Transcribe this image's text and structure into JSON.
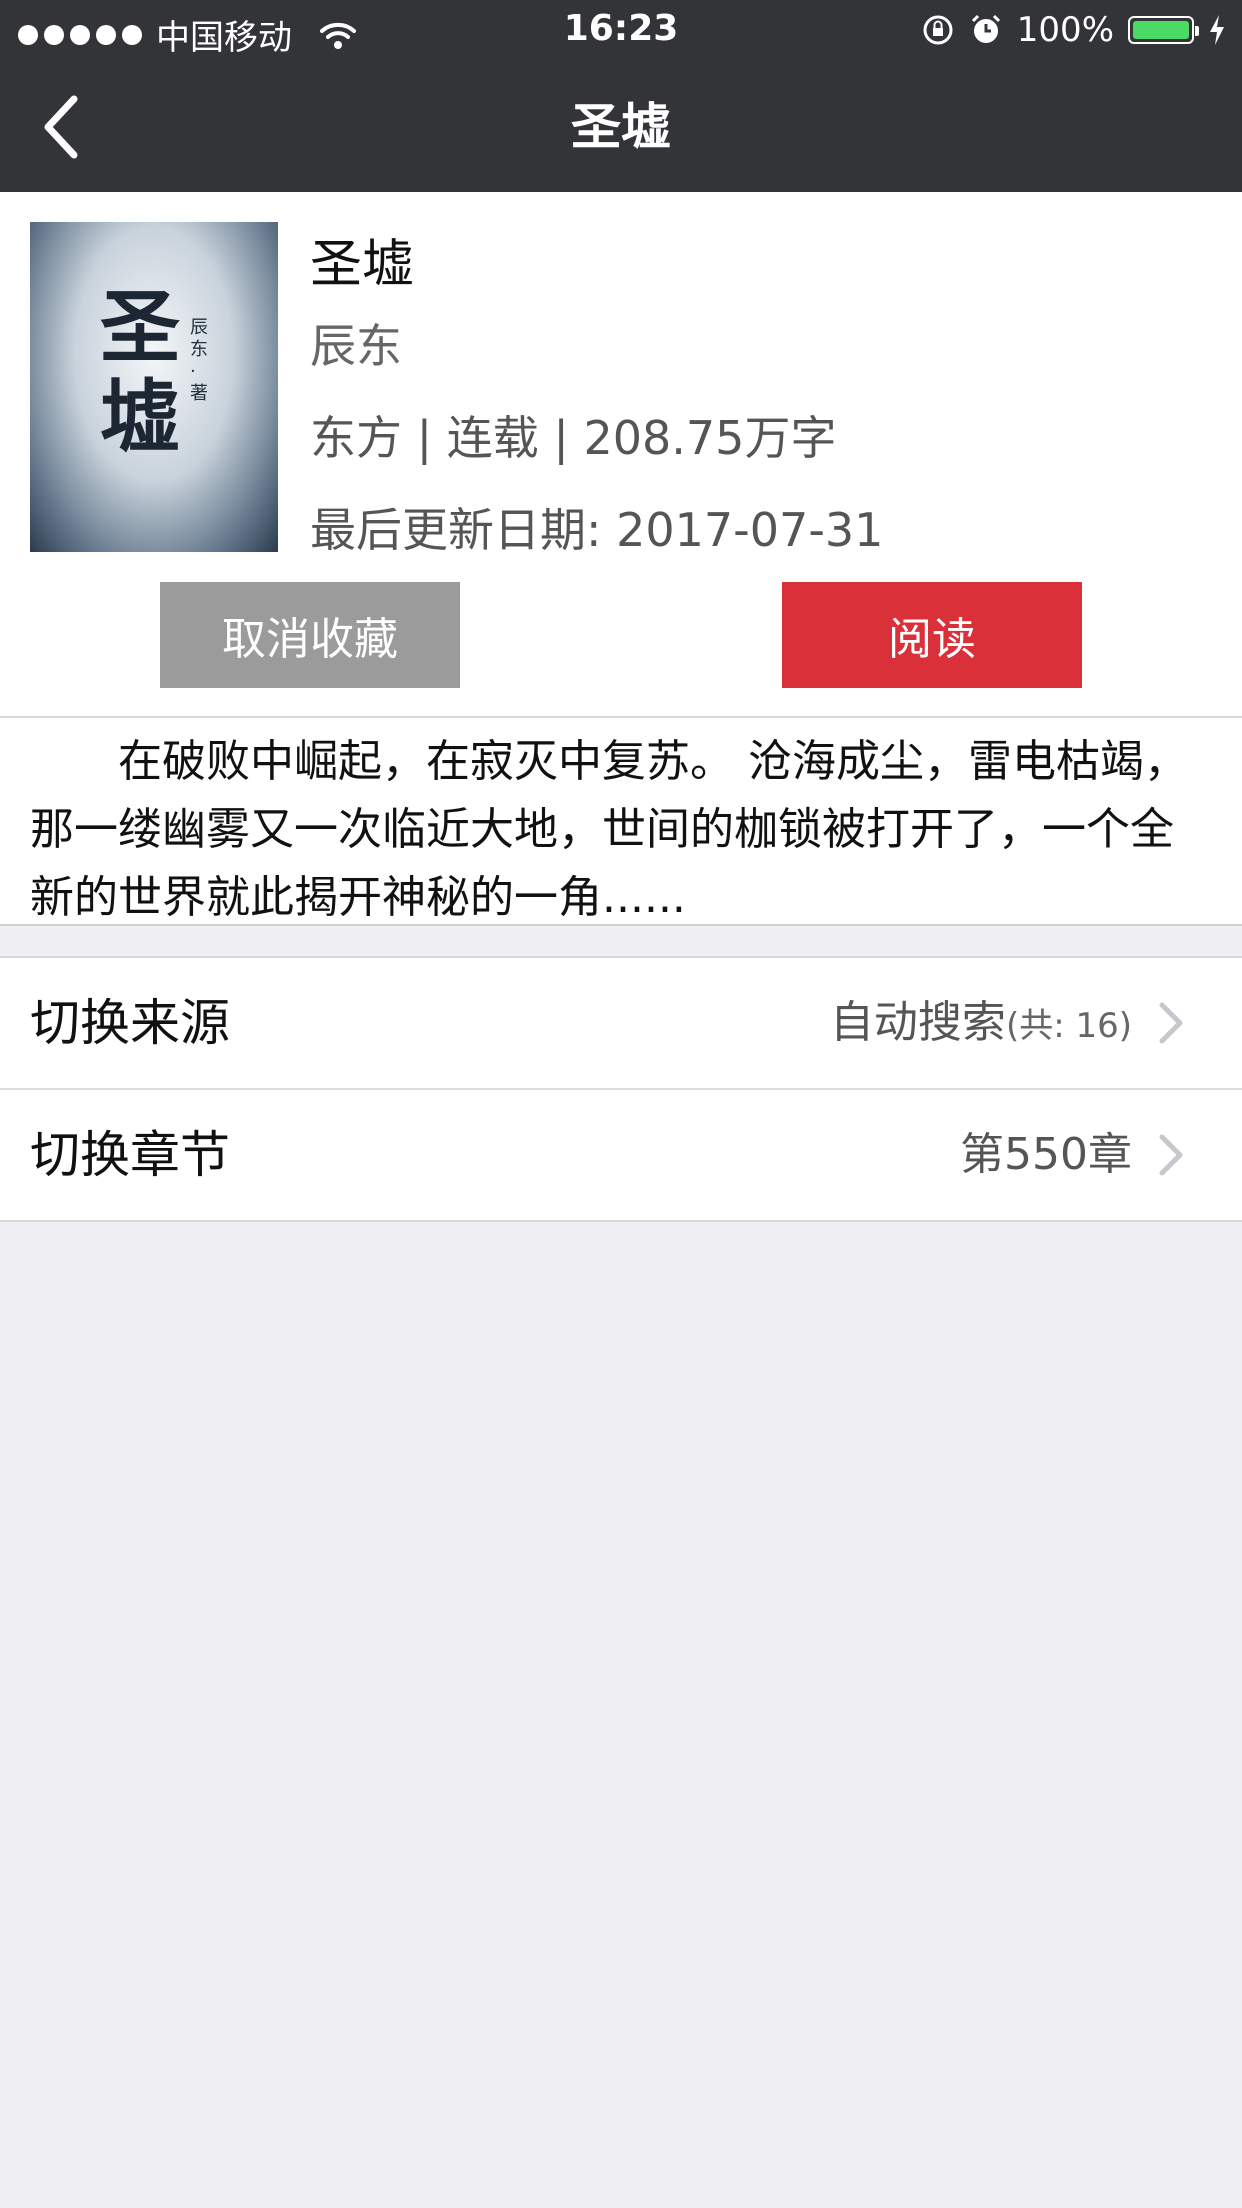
{
  "status_bar": {
    "carrier": "中国移动",
    "time": "16:23",
    "battery": "100%",
    "battery_level": 1.0,
    "battery_color": "#4cd964"
  },
  "nav": {
    "title": "圣墟",
    "back_icon": "chevron-left-icon"
  },
  "book": {
    "cover_title": "圣墟",
    "cover_author_mark": "辰东·著",
    "title": "圣墟",
    "author": "辰东",
    "meta": "东方 | 连载 | 208.75万字",
    "updated": "最后更新日期: 2017-07-31"
  },
  "actions": {
    "unfavorite_label": "取消收藏",
    "read_label": "阅读",
    "unfavorite_color": "#9b9b9b",
    "read_color": "#d9303a"
  },
  "synopsis": "　　在破败中崛起，在寂灭中复苏。 沧海成尘，雷电枯竭，那一缕幽雾又一次临近大地，世间的枷锁被打开了，一个全新的世界就此揭开神秘的一角......",
  "settings": {
    "source": {
      "label": "切换来源",
      "value": "自动搜索",
      "count": "(共: 16)"
    },
    "chapter": {
      "label": "切换章节",
      "value": "第550章"
    }
  }
}
